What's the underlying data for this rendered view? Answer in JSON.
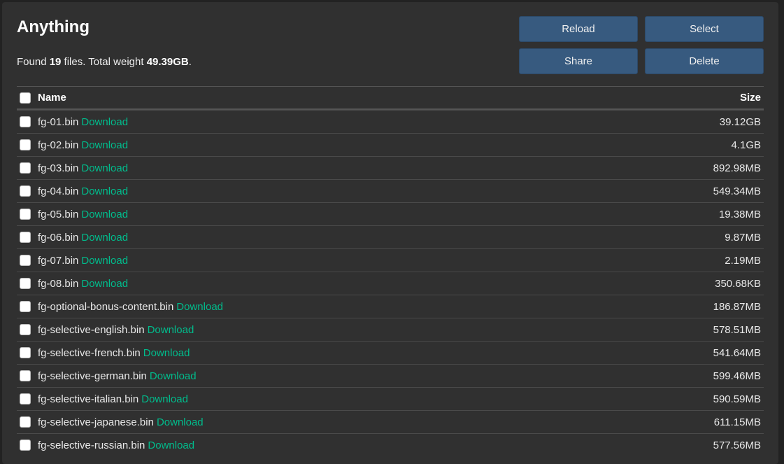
{
  "title": "Anything",
  "summary": {
    "prefix": "Found ",
    "count": "19",
    "middle": " files. Total weight ",
    "weight": "49.39GB",
    "suffix": "."
  },
  "buttons": {
    "reload": "Reload",
    "select": "Select",
    "share": "Share",
    "delete": "Delete"
  },
  "table": {
    "headers": {
      "name": "Name",
      "size": "Size"
    },
    "download_label": "Download",
    "rows": [
      {
        "name": "fg-01.bin",
        "size": "39.12GB"
      },
      {
        "name": "fg-02.bin",
        "size": "4.1GB"
      },
      {
        "name": "fg-03.bin",
        "size": "892.98MB"
      },
      {
        "name": "fg-04.bin",
        "size": "549.34MB"
      },
      {
        "name": "fg-05.bin",
        "size": "19.38MB"
      },
      {
        "name": "fg-06.bin",
        "size": "9.87MB"
      },
      {
        "name": "fg-07.bin",
        "size": "2.19MB"
      },
      {
        "name": "fg-08.bin",
        "size": "350.68KB"
      },
      {
        "name": "fg-optional-bonus-content.bin",
        "size": "186.87MB"
      },
      {
        "name": "fg-selective-english.bin",
        "size": "578.51MB"
      },
      {
        "name": "fg-selective-french.bin",
        "size": "541.64MB"
      },
      {
        "name": "fg-selective-german.bin",
        "size": "599.46MB"
      },
      {
        "name": "fg-selective-italian.bin",
        "size": "590.59MB"
      },
      {
        "name": "fg-selective-japanese.bin",
        "size": "611.15MB"
      },
      {
        "name": "fg-selective-russian.bin",
        "size": "577.56MB"
      }
    ]
  },
  "colors": {
    "background": "#222222",
    "panel": "#303030",
    "button": "#375a7f",
    "link": "#00bc8c"
  }
}
